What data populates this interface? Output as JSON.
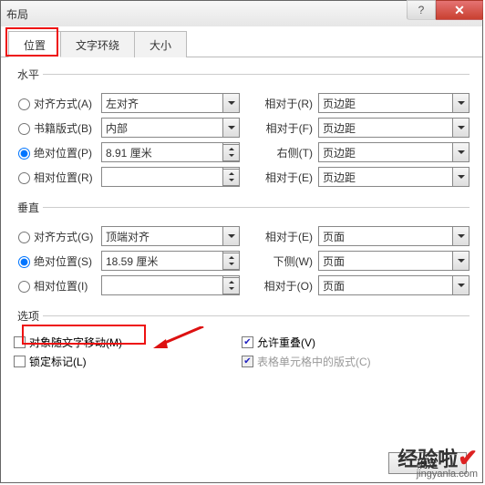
{
  "window": {
    "title": "布局"
  },
  "tabs": [
    "位置",
    "文字环绕",
    "大小"
  ],
  "horizontal": {
    "legend": "水平",
    "align": {
      "label": "对齐方式(A)",
      "value": "左对齐",
      "rel_label": "相对于(R)",
      "rel_value": "页边距"
    },
    "book": {
      "label": "书籍版式(B)",
      "value": "内部",
      "rel_label": "相对于(F)",
      "rel_value": "页边距"
    },
    "abs": {
      "label": "绝对位置(P)",
      "value": "8.91 厘米",
      "rel_label": "右侧(T)",
      "rel_value": "页边距"
    },
    "relp": {
      "label": "相对位置(R)",
      "value": "",
      "rel_label": "相对于(E)",
      "rel_value": "页边距"
    }
  },
  "vertical": {
    "legend": "垂直",
    "align": {
      "label": "对齐方式(G)",
      "value": "顶端对齐",
      "rel_label": "相对于(E)",
      "rel_value": "页面"
    },
    "abs": {
      "label": "绝对位置(S)",
      "value": "18.59 厘米",
      "rel_label": "下侧(W)",
      "rel_value": "页面"
    },
    "relp": {
      "label": "相对位置(I)",
      "value": "",
      "rel_label": "相对于(O)",
      "rel_value": "页面"
    }
  },
  "options": {
    "legend": "选项",
    "move_with_text": "对象随文字移动(M)",
    "lock_anchor": "锁定标记(L)",
    "allow_overlap": "允许重叠(V)",
    "table_layout": "表格单元格中的版式(C)",
    "allow_overlap_checked": true
  },
  "button": {
    "ok": "确定"
  },
  "watermark": {
    "main": "经验啦",
    "sub": "jingyanla.com"
  }
}
